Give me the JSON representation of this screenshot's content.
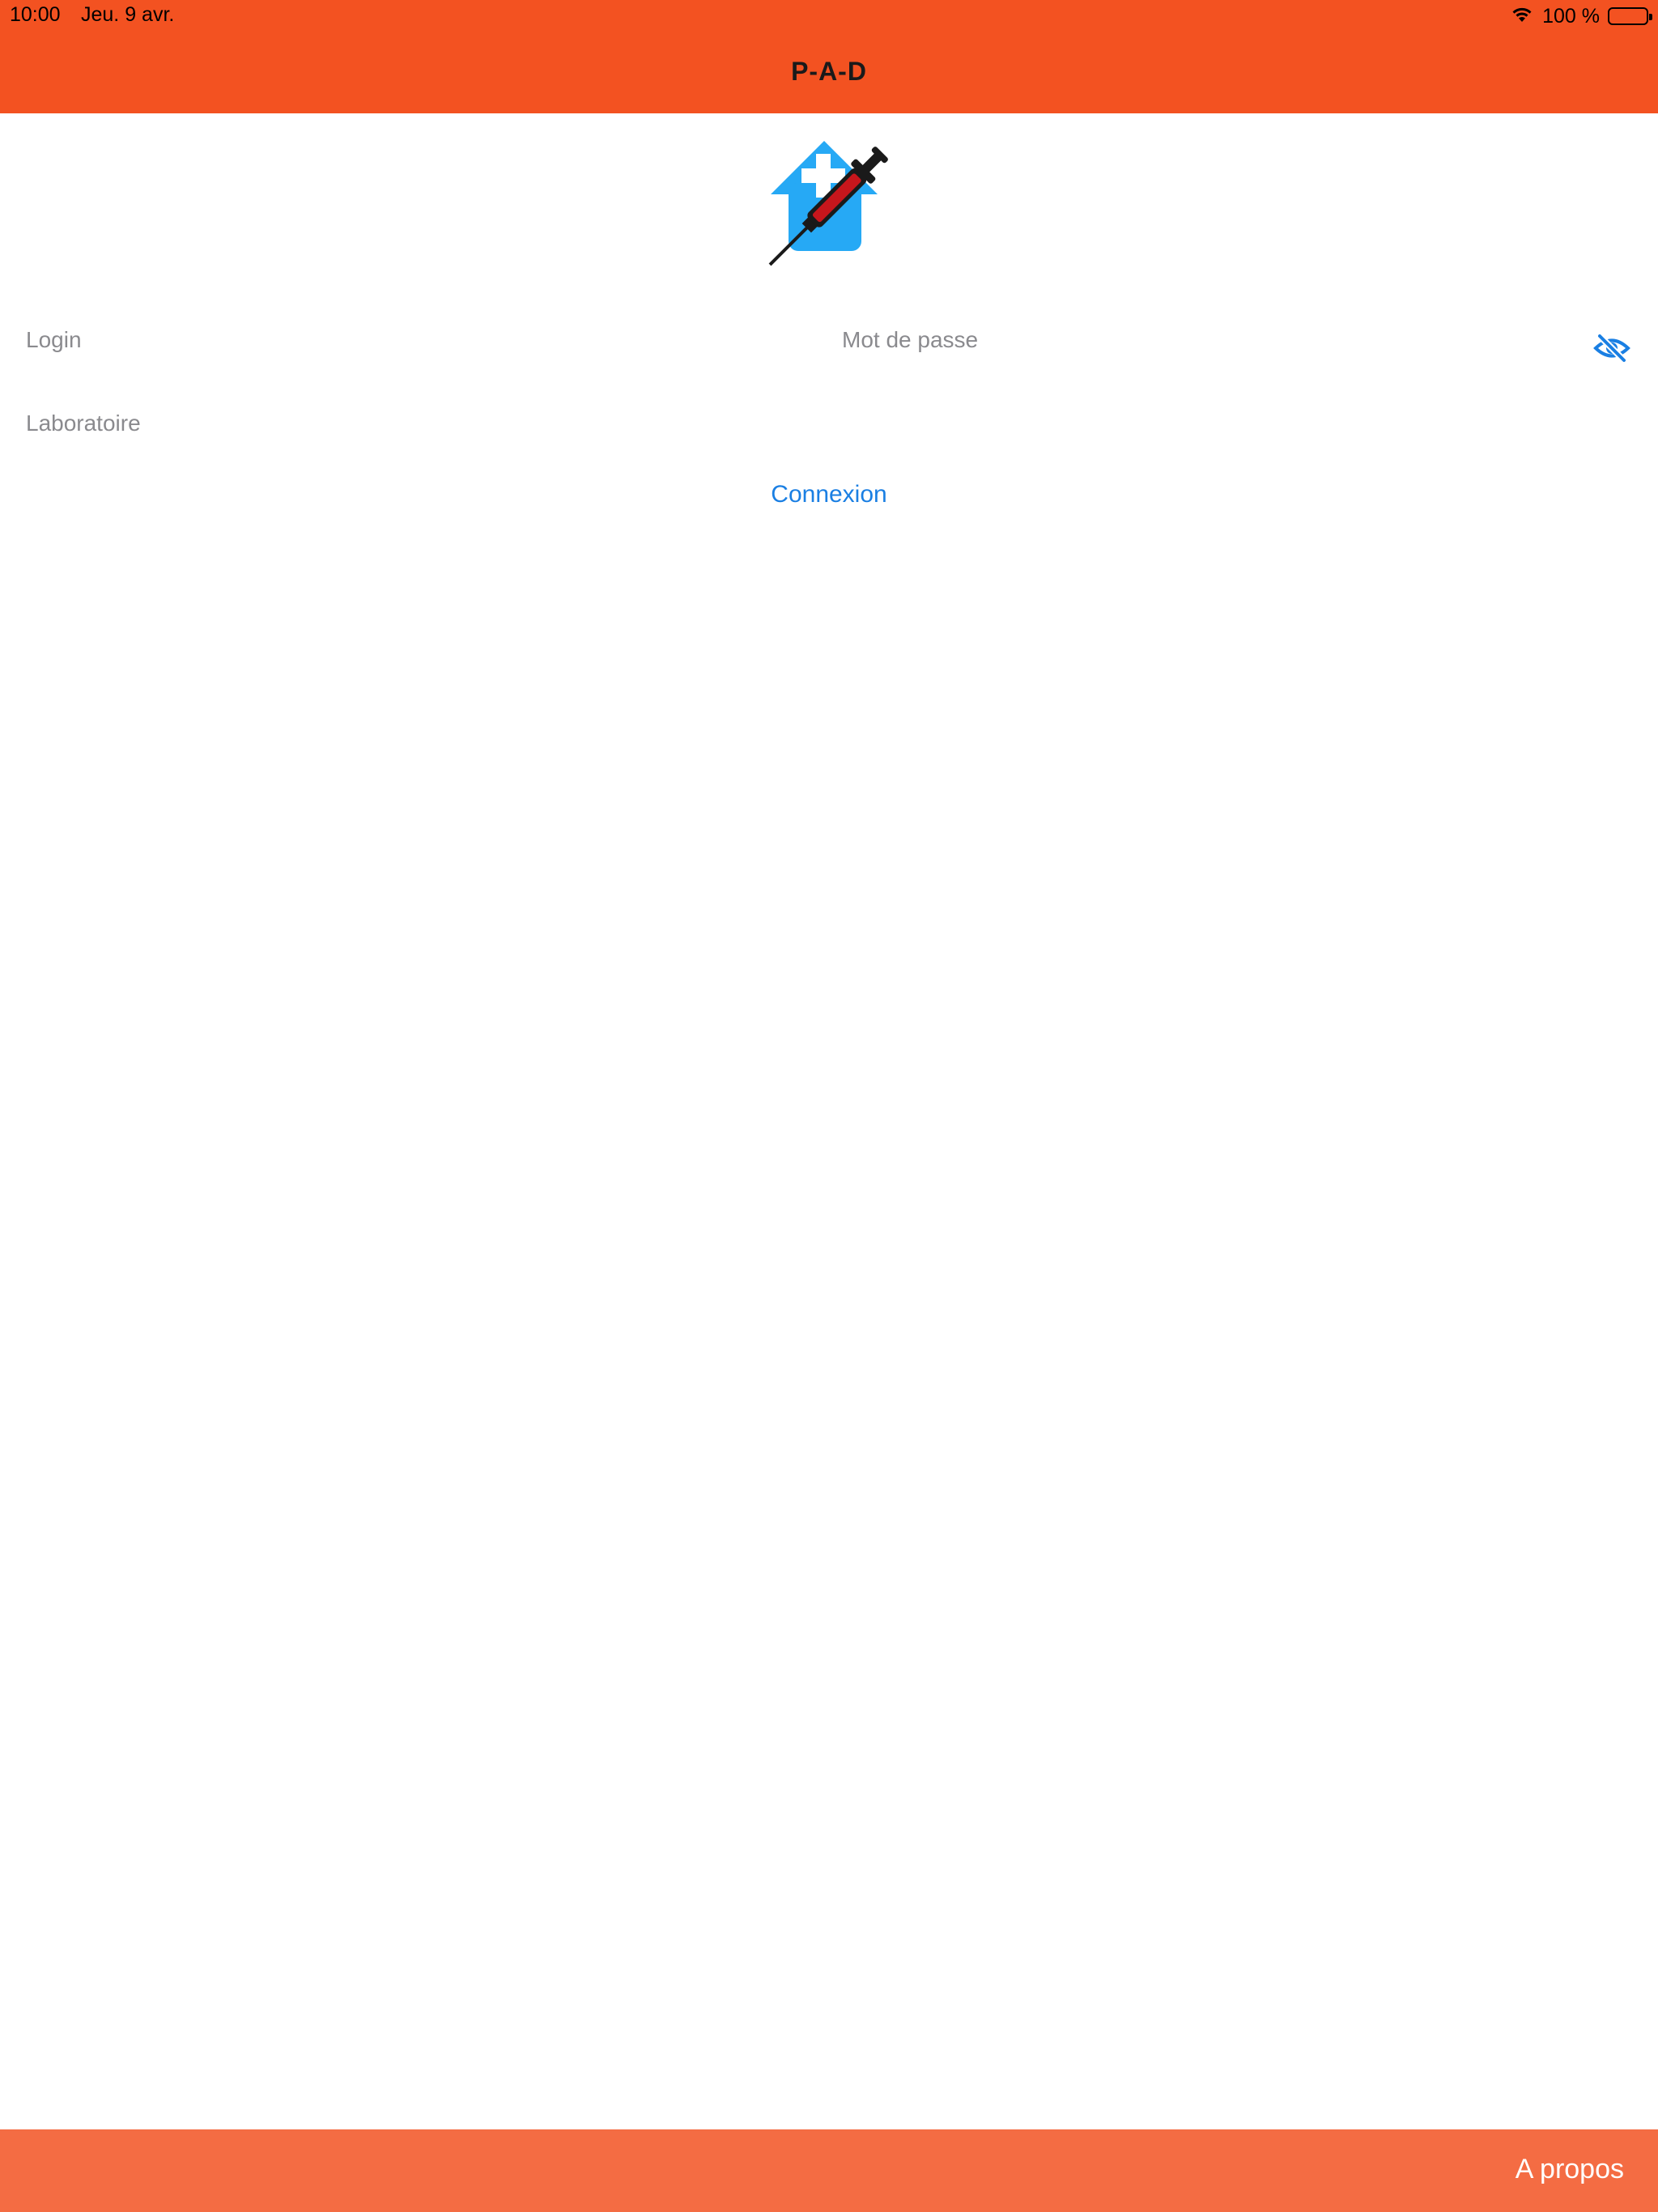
{
  "status_bar": {
    "time": "10:00",
    "date": "Jeu. 9 avr.",
    "battery_text": "100 %"
  },
  "header": {
    "title": "P-A-D",
    "background": "#F35221"
  },
  "form": {
    "login_placeholder": "Login",
    "password_placeholder": "Mot de passe",
    "laboratory_placeholder": "Laboratoire",
    "password_toggle_icon": "eye-slash-icon",
    "connect_label": "Connexion",
    "connect_color": "#1A7FE3"
  },
  "footer": {
    "about_label": "A propos",
    "background": "#F46C43"
  }
}
